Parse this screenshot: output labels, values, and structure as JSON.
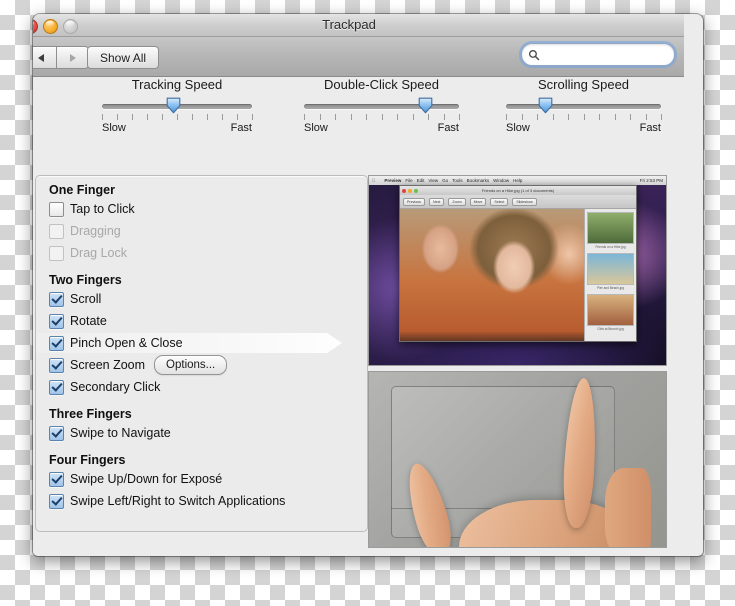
{
  "window": {
    "title": "Trackpad",
    "traffic_lights": [
      "close-button",
      "minimize-button",
      "zoom-button"
    ]
  },
  "toolbar": {
    "back_label": "◀",
    "forward_label": "▶",
    "show_all_label": "Show All",
    "search": {
      "value": "",
      "placeholder": "",
      "icon": "search-icon",
      "focused": true
    }
  },
  "sliders": [
    {
      "title": "Tracking Speed",
      "min_label": "Slow",
      "max_label": "Fast",
      "value_percent": 47,
      "ticks": 10
    },
    {
      "title": "Double-Click Speed",
      "min_label": "Slow",
      "max_label": "Fast",
      "value_percent": 78,
      "ticks": 10
    },
    {
      "title": "Scrolling Speed",
      "min_label": "Slow",
      "max_label": "Fast",
      "value_percent": 25,
      "ticks": 10
    }
  ],
  "options": {
    "groups": [
      {
        "heading": "One Finger",
        "items": [
          {
            "label": "Tap to Click",
            "checked": false,
            "enabled": true,
            "highlighted": false
          },
          {
            "label": "Dragging",
            "checked": false,
            "enabled": false,
            "highlighted": false
          },
          {
            "label": "Drag Lock",
            "checked": false,
            "enabled": false,
            "highlighted": false
          }
        ]
      },
      {
        "heading": "Two Fingers",
        "items": [
          {
            "label": "Scroll",
            "checked": true,
            "enabled": true,
            "highlighted": false
          },
          {
            "label": "Rotate",
            "checked": true,
            "enabled": true,
            "highlighted": false
          },
          {
            "label": "Pinch Open & Close",
            "checked": true,
            "enabled": true,
            "highlighted": true
          },
          {
            "label": "Screen Zoom",
            "checked": true,
            "enabled": true,
            "highlighted": false,
            "button": "Options..."
          },
          {
            "label": "Secondary Click",
            "checked": true,
            "enabled": true,
            "highlighted": false
          }
        ]
      },
      {
        "heading": "Three Fingers",
        "items": [
          {
            "label": "Swipe to Navigate",
            "checked": true,
            "enabled": true,
            "highlighted": false
          }
        ]
      },
      {
        "heading": "Four Fingers",
        "items": [
          {
            "label": "Swipe Up/Down for Exposé",
            "checked": true,
            "enabled": true,
            "highlighted": false
          },
          {
            "label": "Swipe Left/Right to Switch Applications",
            "checked": true,
            "enabled": true,
            "highlighted": false
          }
        ]
      }
    ]
  },
  "preview": {
    "video": {
      "name": "gesture-demo-video",
      "menubar": [
        "Preview",
        "File",
        "Edit",
        "View",
        "Go",
        "Tools",
        "Bookmarks",
        "Window",
        "Help"
      ],
      "menubar_right": "Fri 2:53 PM",
      "inner_window_title": "Friends on a Hike.jpg (1 of 3 documents)",
      "toolbar_items": [
        "Previous",
        "Next",
        "Zoom",
        "Move",
        "Select",
        "Slideshow"
      ],
      "sidebar_thumbs": [
        {
          "caption": "Friends on a Hike.jpg"
        },
        {
          "caption": "Pier and Beach.jpg"
        },
        {
          "caption": "Girls at Brunch.jpg"
        }
      ]
    },
    "photo": {
      "name": "trackpad-hand-photo",
      "description": "Two fingers pinching on trackpad"
    }
  },
  "colors": {
    "accent": "#6ea0e1",
    "checkbox_check": "#1b3f6b",
    "window_bg": "#ececec",
    "panel_bg": "#ebebeb"
  }
}
